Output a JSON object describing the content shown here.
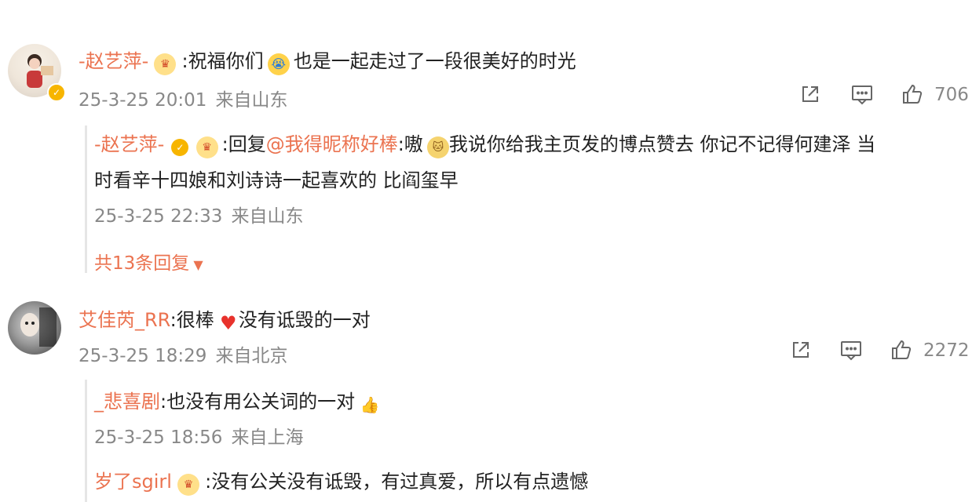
{
  "comment1": {
    "username": "-赵艺萍-",
    "text_pre": ":祝福你们",
    "text_post": " 也是一起走过了一段很美好的时光",
    "time": "25-3-25 20:01",
    "location": "来自山东",
    "likes": "706",
    "reply": {
      "username": "-赵艺萍-",
      "prefix": ":回复",
      "mention": "@我得昵称好棒",
      "line1_pre": ":嗷",
      "line1_post": "我说你给我主页发的博点赞去 你记不记得何建泽 当",
      "line2": "时看辛十四娘和刘诗诗一起喜欢的 比阎玺早",
      "time": "25-3-25 22:33",
      "location": "来自山东"
    },
    "more_replies": "共13条回复"
  },
  "comment2": {
    "username": "艾佳芮_RR",
    "text_pre": ":很棒",
    "text_post": "没有诋毁的一对",
    "time": "25-3-25 18:29",
    "location": "来自北京",
    "likes": "2272",
    "reply1": {
      "username": "_悲喜剧",
      "text": ":也没有用公关词的一对",
      "time": "25-3-25 18:56",
      "location": "来自上海"
    },
    "reply2": {
      "username": "岁了sgirl",
      "text": ":没有公关没有诋毁，有过真爱，所以有点遗憾"
    }
  },
  "icons": [
    "share-icon",
    "comment-icon",
    "like-icon",
    "crown-badge-icon",
    "verified-icon",
    "crying-emoji-icon",
    "heart-emoji-icon",
    "thumbs-up-emoji-icon",
    "cat-emoji-icon",
    "caret-down-icon"
  ],
  "colors": {
    "username": "#eb7350",
    "meta": "#888888",
    "text": "#222222",
    "verified": "#f7b500"
  }
}
